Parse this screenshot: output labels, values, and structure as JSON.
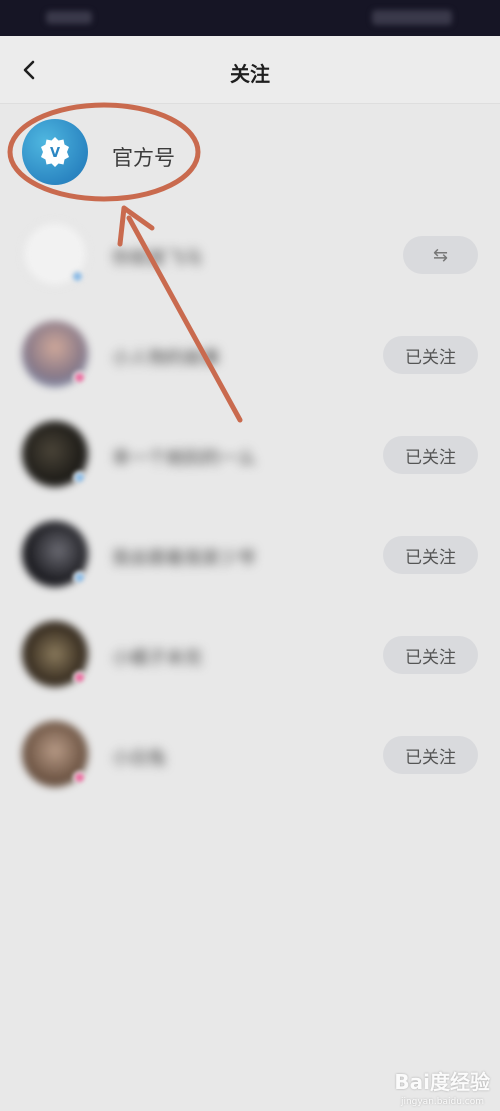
{
  "header": {
    "title": "关注"
  },
  "official": {
    "name": "官方号",
    "avatar_glyph": "V"
  },
  "rows": [
    {
      "name": "你就是飞马",
      "button": "⇆",
      "kind": "mutual"
    },
    {
      "name": "小人物的故事",
      "button": "已关注",
      "kind": "follow"
    },
    {
      "name": "幸一个她别的一么",
      "button": "已关注",
      "kind": "follow"
    },
    {
      "name": "我会跟着我家少爷",
      "button": "已关注",
      "kind": "follow"
    },
    {
      "name": "小橘子未完",
      "button": "已关注",
      "kind": "follow"
    },
    {
      "name": "小白兔",
      "button": "已关注",
      "kind": "follow"
    }
  ],
  "watermark": {
    "text": "Bai度经验",
    "sub": "jingyan.baidu.com"
  },
  "colors": {
    "annotation": "#c96a4e",
    "official_avatar": "#2b86c2",
    "button_bg": "#d9dadd",
    "status_bar": "#161525"
  }
}
